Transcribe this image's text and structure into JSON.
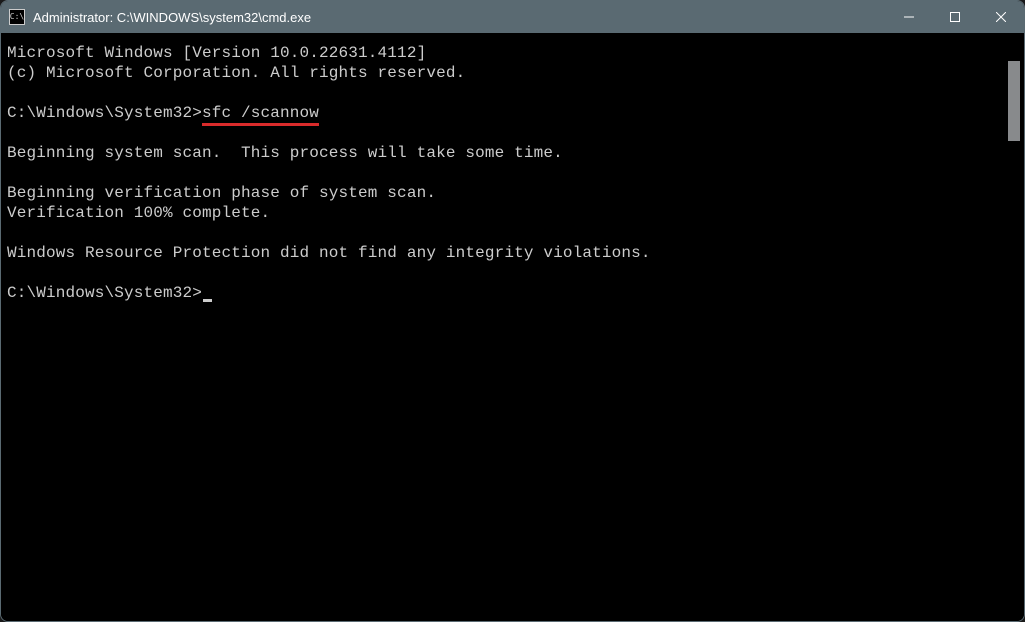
{
  "window": {
    "title": "Administrator: C:\\WINDOWS\\system32\\cmd.exe",
    "icon_label": "C:\\"
  },
  "terminal": {
    "line1": "Microsoft Windows [Version 10.0.22631.4112]",
    "line2": "(c) Microsoft Corporation. All rights reserved.",
    "prompt1_prefix": "C:\\Windows\\System32>",
    "prompt1_command": "sfc /scannow",
    "line3": "Beginning system scan.  This process will take some time.",
    "line4": "Beginning verification phase of system scan.",
    "line5": "Verification 100% complete.",
    "line6": "Windows Resource Protection did not find any integrity violations.",
    "prompt2": "C:\\Windows\\System32>"
  }
}
